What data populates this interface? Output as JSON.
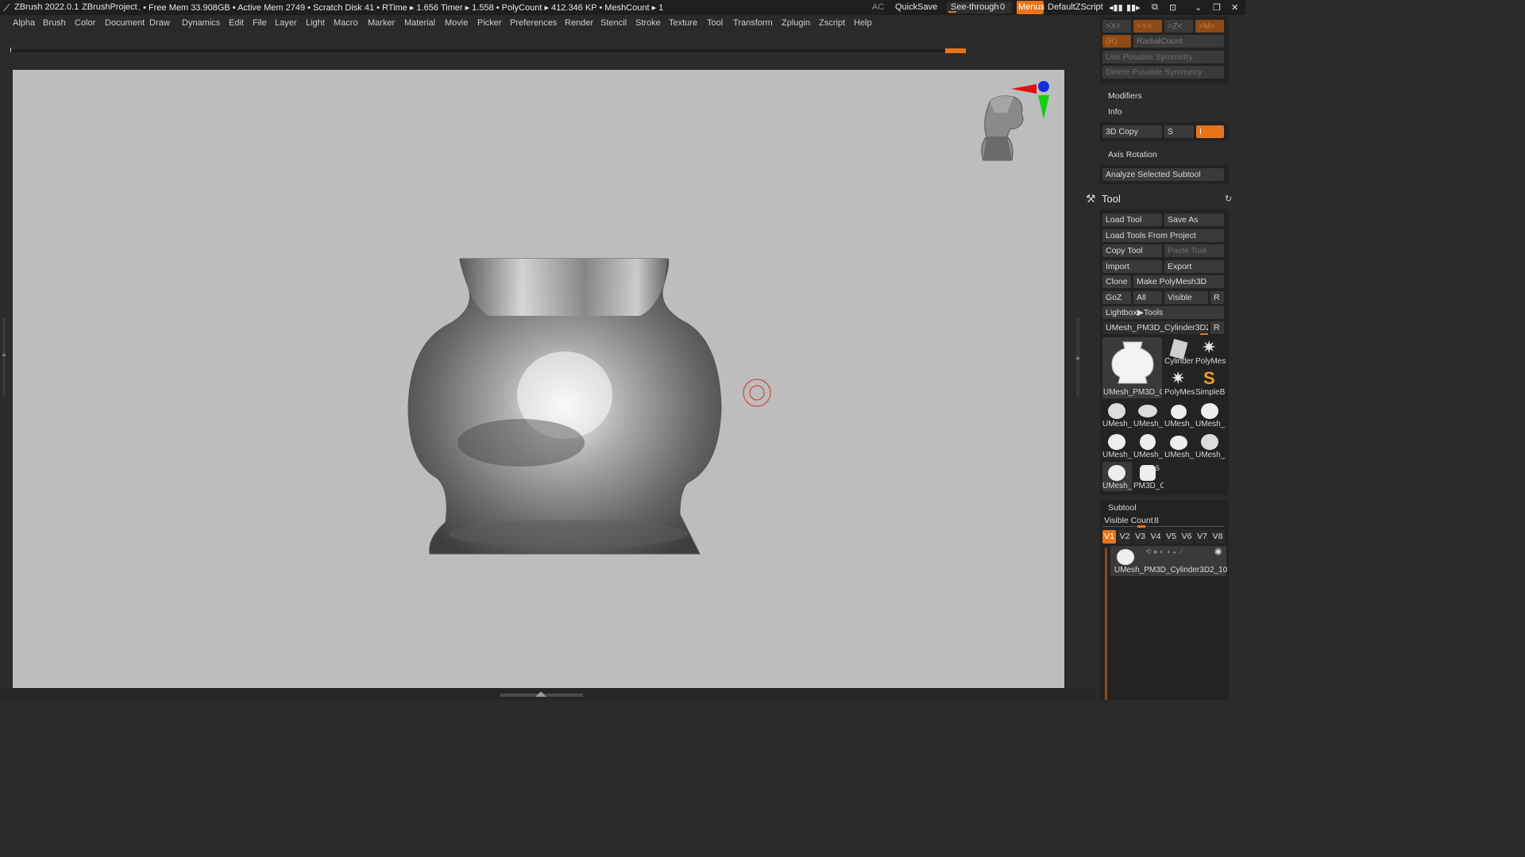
{
  "titlebar": {
    "app": "ZBrush 2022.0.1",
    "project": "ZBrushProject",
    "stats": ". • Free Mem 33.908GB • Active Mem 2749 • Scratch Disk 41 • RTime ▸ 1.656 Timer ▸ 1.558 • PolyCount ▸ 412.346 KP • MeshCount ▸ 1",
    "ac": "AC",
    "quicksave": "QuickSave",
    "seethrough_label": "See-through",
    "seethrough_value": "0",
    "menus": "Menus",
    "script": "DefaultZScript",
    "accent": "#e8741a"
  },
  "menu": [
    "Alpha",
    "Brush",
    "Color",
    "Document",
    "Draw",
    "Dynamics",
    "Edit",
    "File",
    "Layer",
    "Light",
    "Macro",
    "Marker",
    "Material",
    "Movie",
    "Picker",
    "Preferences",
    "Render",
    "Stencil",
    "Stroke",
    "Texture",
    "Tool",
    "Transform",
    "Zplugin",
    "Zscript",
    "Help"
  ],
  "right": {
    "sym_x": ">X<",
    "sym_y": ">Y<",
    "sym_z": ">Z<",
    "sym_m": ">M<",
    "sym_r": "(R)",
    "radialcount": "RadialCount",
    "use_posable": "Use Posable Symmetry",
    "delete_posable": "Delete Posable Symmetry",
    "modifiers": "Modifiers",
    "info": "Info",
    "copy3d": "3D Copy",
    "copy3d_s": "S",
    "copy3d_i": "I",
    "axis_rotation": "Axis Rotation",
    "analyze": "Analyze Selected Subtool"
  },
  "tool": {
    "title": "Tool",
    "load_tool": "Load Tool",
    "save_as": "Save As",
    "load_from_project": "Load Tools From Project",
    "copy_tool": "Copy Tool",
    "paste_tool": "Paste Tool",
    "import": "Import",
    "export": "Export",
    "clone": "Clone",
    "make_polymesh": "Make PolyMesh3D",
    "goz": "GoZ",
    "all": "All",
    "visible": "Visible",
    "r": "R",
    "lightbox": "Lightbox▶Tools",
    "current_tool": "UMesh_PM3D_Cylinder3D2_1",
    "current_r": "R",
    "thumbs": {
      "main": "UMesh_PM3D_C",
      "cylinder": "Cylinder",
      "polymesh1": "PolyMes",
      "polymesh2": "PolyMes",
      "simpleb": "SimpleB",
      "u1": "UMesh_",
      "u2": "UMesh_",
      "u3": "UMesh_",
      "u4": "UMesh_",
      "u5": "UMesh_",
      "u6": "UMesh_",
      "u7": "UMesh_",
      "u8": "UMesh_",
      "u9": "UMesh_",
      "pm3d": "PM3D_C",
      "pm3d_num": "5"
    }
  },
  "subtool": {
    "title": "Subtool",
    "visible_count_label": "Visible Count",
    "visible_count": "8",
    "versions": [
      "V1",
      "V2",
      "V3",
      "V4",
      "V5",
      "V6",
      "V7",
      "V8"
    ],
    "item_name": "UMesh_PM3D_Cylinder3D2_10"
  }
}
